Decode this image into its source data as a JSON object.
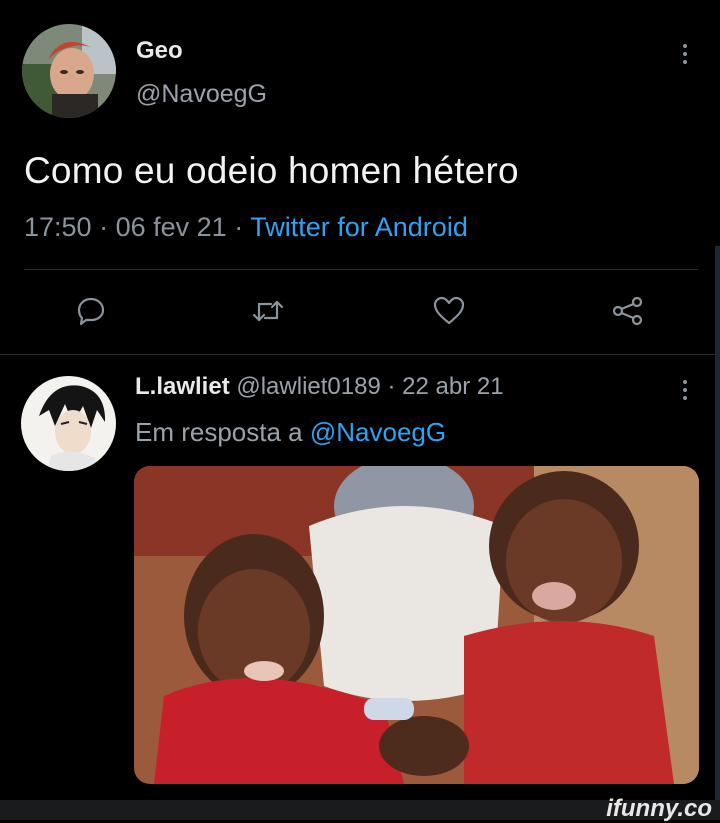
{
  "tweet": {
    "author_name": "Geo",
    "author_handle": "@NavoegG",
    "text": "Como eu odeio homen hétero",
    "time": "17:50",
    "date": "06 fev 21",
    "separator": "·",
    "source": "Twitter for Android",
    "actions": [
      "reply-icon",
      "retweet-icon",
      "like-icon",
      "share-icon"
    ]
  },
  "reply": {
    "author_name": "L.lawliet",
    "author_handle": "@lawliet0189",
    "date": "22 abr 21",
    "separator": "·",
    "reply_prefix": "Em resposta a",
    "reply_mention": "@NavoegG"
  },
  "watermark": "ifunny.co",
  "colors": {
    "background": "#000000",
    "link": "#2ea3f2",
    "secondary_text": "#8b949c"
  }
}
